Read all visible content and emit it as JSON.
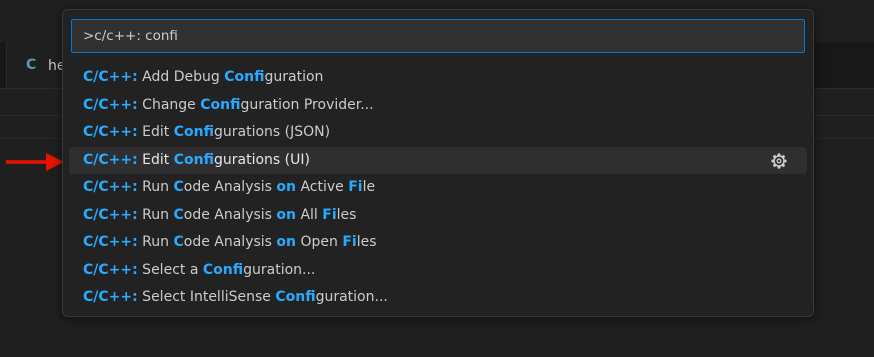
{
  "editor": {
    "tab": {
      "icon": "C",
      "label": "he"
    }
  },
  "quick_pick": {
    "input_value": ">c/c++: confi",
    "items": [
      {
        "segments": [
          {
            "t": "C/C++:",
            "h": true
          },
          {
            "t": " Add Debug ",
            "h": false
          },
          {
            "t": "Confi",
            "h": true
          },
          {
            "t": "guration",
            "h": false
          }
        ],
        "focused": false,
        "action_icon": null
      },
      {
        "segments": [
          {
            "t": "C/C++:",
            "h": true
          },
          {
            "t": " Change ",
            "h": false
          },
          {
            "t": "Confi",
            "h": true
          },
          {
            "t": "guration Provider...",
            "h": false
          }
        ],
        "focused": false,
        "action_icon": null
      },
      {
        "segments": [
          {
            "t": "C/C++:",
            "h": true
          },
          {
            "t": " Edit ",
            "h": false
          },
          {
            "t": "Confi",
            "h": true
          },
          {
            "t": "gurations (JSON)",
            "h": false
          }
        ],
        "focused": false,
        "action_icon": null
      },
      {
        "segments": [
          {
            "t": "C/C++:",
            "h": true
          },
          {
            "t": " Edit ",
            "h": false
          },
          {
            "t": "Confi",
            "h": true
          },
          {
            "t": "gurations (UI)",
            "h": false
          }
        ],
        "focused": true,
        "action_icon": "gear-icon"
      },
      {
        "segments": [
          {
            "t": "C/C++:",
            "h": true
          },
          {
            "t": " Run ",
            "h": false
          },
          {
            "t": "C",
            "h": true
          },
          {
            "t": "ode Analysis ",
            "h": false
          },
          {
            "t": "on",
            "h": true
          },
          {
            "t": " Active ",
            "h": false
          },
          {
            "t": "Fi",
            "h": true
          },
          {
            "t": "le",
            "h": false
          }
        ],
        "focused": false,
        "action_icon": null
      },
      {
        "segments": [
          {
            "t": "C/C++:",
            "h": true
          },
          {
            "t": " Run ",
            "h": false
          },
          {
            "t": "C",
            "h": true
          },
          {
            "t": "ode Analysis ",
            "h": false
          },
          {
            "t": "on",
            "h": true
          },
          {
            "t": " All ",
            "h": false
          },
          {
            "t": "Fi",
            "h": true
          },
          {
            "t": "les",
            "h": false
          }
        ],
        "focused": false,
        "action_icon": null
      },
      {
        "segments": [
          {
            "t": "C/C++:",
            "h": true
          },
          {
            "t": " Run ",
            "h": false
          },
          {
            "t": "C",
            "h": true
          },
          {
            "t": "ode Analysis ",
            "h": false
          },
          {
            "t": "on",
            "h": true
          },
          {
            "t": " Open ",
            "h": false
          },
          {
            "t": "Fi",
            "h": true
          },
          {
            "t": "les",
            "h": false
          }
        ],
        "focused": false,
        "action_icon": null
      },
      {
        "segments": [
          {
            "t": "C/C++:",
            "h": true
          },
          {
            "t": " Select a ",
            "h": false
          },
          {
            "t": "Confi",
            "h": true
          },
          {
            "t": "guration...",
            "h": false
          }
        ],
        "focused": false,
        "action_icon": null
      },
      {
        "segments": [
          {
            "t": "C/C++:",
            "h": true
          },
          {
            "t": " Select IntelliSense ",
            "h": false
          },
          {
            "t": "Confi",
            "h": true
          },
          {
            "t": "guration...",
            "h": false
          }
        ],
        "focused": false,
        "action_icon": null
      }
    ]
  },
  "annotation": {
    "arrow_color": "#e51400",
    "icon": "red-arrow-icon"
  },
  "colors": {
    "accent_border": "#0078d4",
    "match_highlight": "#2aaaff",
    "background": "#1f1f1f"
  }
}
